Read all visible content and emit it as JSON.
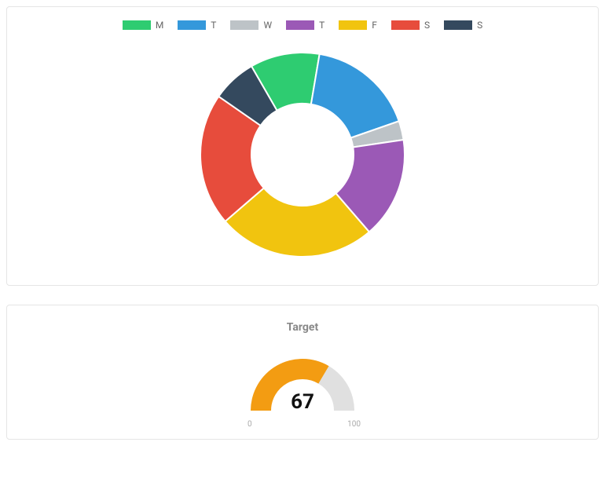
{
  "chart_data": [
    {
      "type": "pie",
      "variant": "donut",
      "categories": [
        "M",
        "T",
        "W",
        "T",
        "F",
        "S",
        "S"
      ],
      "values": [
        11,
        17,
        3,
        16,
        25,
        21,
        7
      ],
      "colors": [
        "#2ecc71",
        "#3498db",
        "#bdc3c7",
        "#9b59b6",
        "#f1c40f",
        "#e74c3c",
        "#34495e"
      ],
      "start_angle_deg": -30,
      "inner_radius_ratio": 0.5
    },
    {
      "type": "gauge",
      "title": "Target",
      "value": 67,
      "min": 0,
      "max": 100,
      "fill_color": "#f39c12",
      "track_color": "#e0e0e0"
    }
  ]
}
